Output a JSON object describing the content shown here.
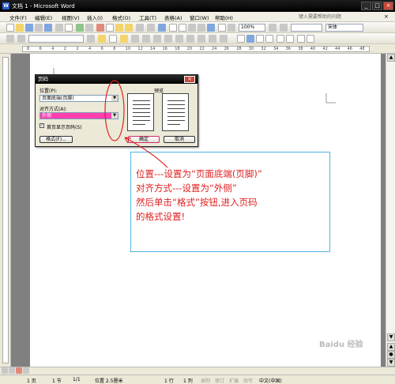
{
  "window": {
    "title": "文档 1 - Microsoft Word",
    "controls": [
      "_",
      "□",
      "×"
    ]
  },
  "menu": {
    "items": [
      "文件(F)",
      "编辑(E)",
      "视图(V)",
      "插入(I)",
      "格式(O)",
      "工具(T)",
      "表格(A)",
      "窗口(W)",
      "帮助(H)"
    ],
    "help_placeholder": "键入需要帮助的问题",
    "close": "×"
  },
  "toolbar": {
    "zoom": "100%",
    "font": "宋体"
  },
  "ruler": {
    "ticks": [
      "8",
      "6",
      "4",
      "2",
      "2",
      "4",
      "6",
      "8",
      "10",
      "12",
      "14",
      "16",
      "18",
      "20",
      "22",
      "24",
      "26",
      "28",
      "30",
      "32",
      "34",
      "36",
      "38",
      "40",
      "42",
      "44",
      "46",
      "48"
    ]
  },
  "dialog": {
    "title": "页码",
    "position_label": "位置(P):",
    "position_value": "页面底端(页脚)",
    "align_label": "对齐方式(A):",
    "align_value": "外侧",
    "preview_label": "预览",
    "first_page_label": "首页显示页码(S)",
    "first_page_checked": true,
    "format_button": "格式(F)...",
    "ok_button": "确定",
    "cancel_button": "取消",
    "close": "×"
  },
  "callout": {
    "lines": [
      "位置---设置为“页面底端(页脚)”",
      "对齐方式---设置为“外侧”",
      "然后单击“格式”按钮,进入页码",
      "的格式设置!"
    ],
    "color": "#e02020",
    "border_color": "#4fb6e0"
  },
  "status": {
    "page": "1 页",
    "section": "1 节",
    "page_of": "1/1",
    "position": "位置 2.5厘米",
    "line": "1 行",
    "column": "1 列",
    "modes": [
      "录制",
      "修订",
      "扩展",
      "改写"
    ],
    "language": "中文(中国)"
  },
  "watermark": "Baidu 经验",
  "colors": {
    "annotation": "#e02020",
    "highlight": "#ff3fb0"
  }
}
